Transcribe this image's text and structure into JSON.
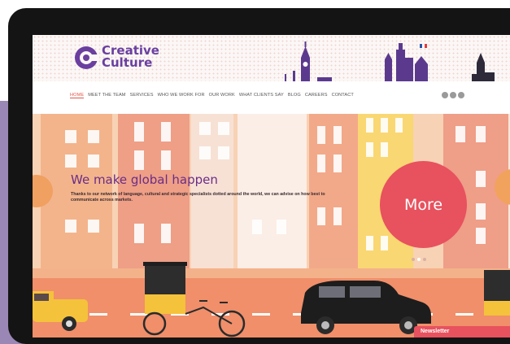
{
  "brand": {
    "line1": "Creative",
    "line2": "Culture",
    "color": "#6a3fa0"
  },
  "nav": {
    "items": [
      "HOME",
      "MEET THE TEAM",
      "SERVICES",
      "WHO WE WORK FOR",
      "OUR WORK",
      "WHAT CLIENTS SAY",
      "BLOG",
      "CAREERS",
      "CONTACT"
    ],
    "active_index": 0,
    "social_icons": [
      "linkedin-icon",
      "twitter-icon",
      "email-icon"
    ]
  },
  "hero": {
    "title": "We make global happen",
    "body": "Thanks to our network of language, cultural and strategic specialists dotted around the world, we can advise on how best to communicate across markets.",
    "more_label": "More",
    "slide_dots": 3,
    "active_dot": 1
  },
  "newsletter": {
    "label": "Newsletter"
  },
  "colors": {
    "accent": "#e8515e",
    "title": "#6b2d86",
    "frame": "#141414",
    "side_band": "#9b87b5",
    "hero_bg": "#f6c6a4"
  }
}
